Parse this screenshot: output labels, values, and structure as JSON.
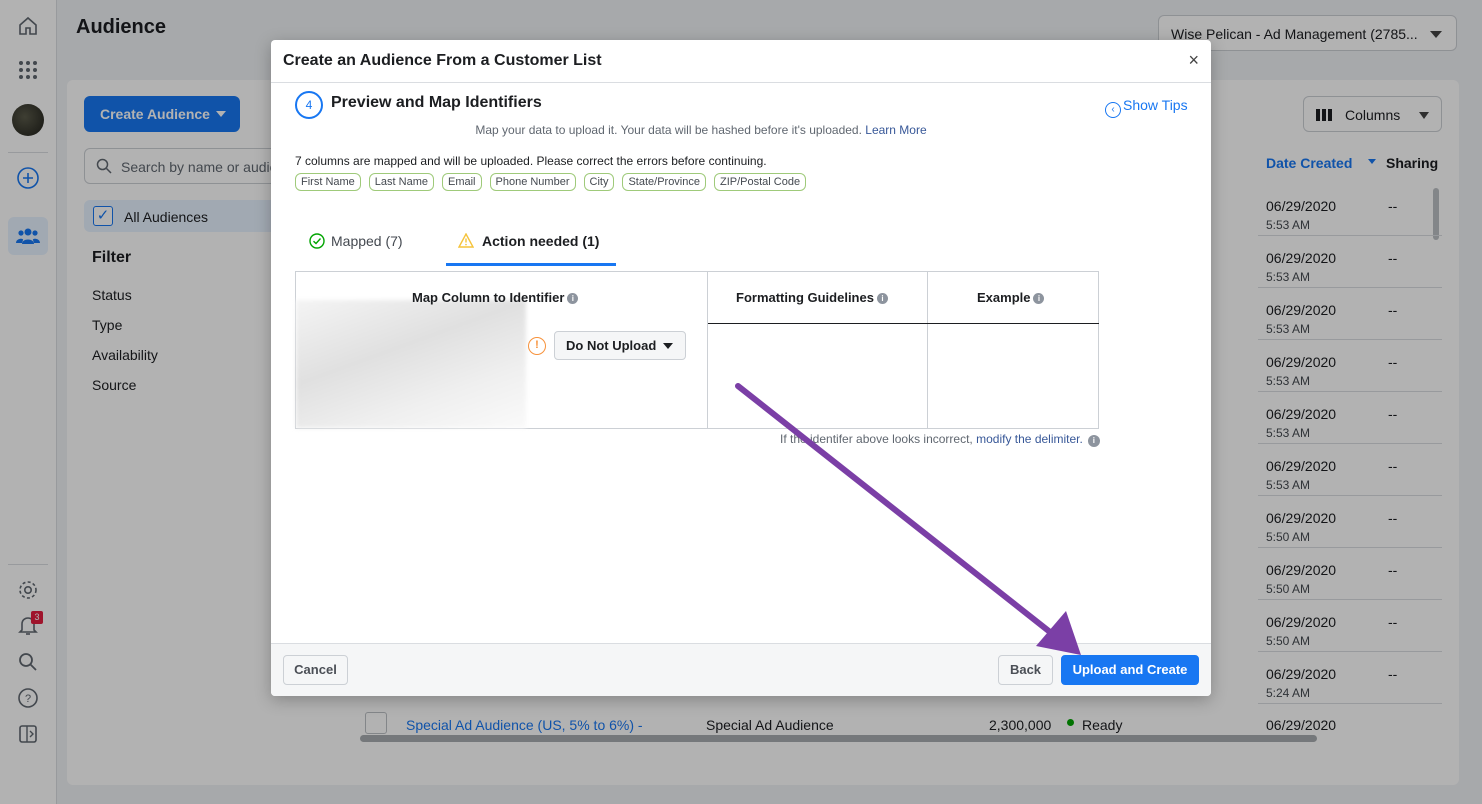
{
  "page": {
    "title": "Audience",
    "account_selector": "Wise Pelican - Ad Management (2785...",
    "create_audience_label": "Create Audience",
    "search_placeholder": "Search by name or audie",
    "all_audiences_label": "All Audiences",
    "filter_title": "Filter",
    "filters": [
      "Status",
      "Type",
      "Availability",
      "Source"
    ],
    "columns_label": "Columns",
    "col_date_created": "Date Created",
    "col_sharing": "Sharing",
    "rows": [
      {
        "date": "06/29/2020",
        "time": "5:53 AM",
        "sharing": "--"
      },
      {
        "date": "06/29/2020",
        "time": "5:53 AM",
        "sharing": "--"
      },
      {
        "date": "06/29/2020",
        "time": "5:53 AM",
        "sharing": "--"
      },
      {
        "date": "06/29/2020",
        "time": "5:53 AM",
        "sharing": "--"
      },
      {
        "date": "06/29/2020",
        "time": "5:53 AM",
        "sharing": "--"
      },
      {
        "date": "06/29/2020",
        "time": "5:53 AM",
        "sharing": "--"
      },
      {
        "date": "06/29/2020",
        "time": "5:50 AM",
        "sharing": "--"
      },
      {
        "date": "06/29/2020",
        "time": "5:50 AM",
        "sharing": "--"
      },
      {
        "date": "06/29/2020",
        "time": "5:50 AM",
        "sharing": "--"
      },
      {
        "date": "06/29/2020",
        "time": "5:24 AM",
        "sharing": "--"
      }
    ],
    "bottom_row": {
      "name": "Special Ad Audience (US, 5% to 6%) -",
      "type": "Special Ad Audience",
      "size": "2,300,000",
      "status": "Ready",
      "date": "06/29/2020"
    },
    "notification_count": "3"
  },
  "modal": {
    "title": "Create an Audience From a Customer List",
    "close_symbol": "×",
    "step_number": "4",
    "step_title": "Preview and Map Identifiers",
    "show_tips": "Show Tips",
    "subtext": "Map your data to upload it. Your data will be hashed before it's uploaded.",
    "learn_more": "Learn More",
    "mapped_note": "7 columns are mapped and will be uploaded. Please correct the errors before continuing.",
    "mapped_tags": [
      "First Name",
      "Last Name",
      "Email",
      "Phone Number",
      "City",
      "State/Province",
      "ZIP/Postal Code"
    ],
    "tab_mapped": "Mapped (7)",
    "tab_action": "Action needed (1)",
    "col_map": "Map Column to Identifier",
    "col_guidelines": "Formatting Guidelines",
    "col_example": "Example",
    "warn_symbol": "!",
    "do_not_upload": "Do Not Upload",
    "delimiter_note": "If the identifer above looks incorrect,",
    "delimiter_link": "modify the delimiter.",
    "cancel": "Cancel",
    "back": "Back",
    "upload_create": "Upload and Create"
  },
  "colors": {
    "primary": "#1877f2",
    "annotation_arrow": "#7b3fa6",
    "ready_dot": "#00a400",
    "warning": "#f7923b"
  }
}
